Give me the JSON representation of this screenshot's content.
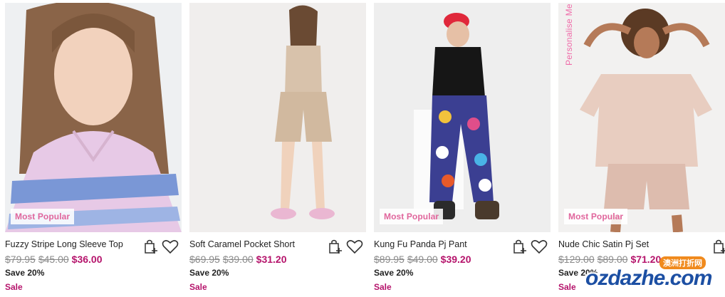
{
  "products": [
    {
      "name": "Fuzzy Stripe Long Sleeve Top",
      "badge": "Most Popular",
      "was": "$79.95",
      "was2": "$45.00",
      "now": "$36.00",
      "save": "Save 20%",
      "sale": "Sale"
    },
    {
      "name": "Soft Caramel Pocket Short",
      "badge": "",
      "was": "$69.95",
      "was2": "$39.00",
      "now": "$31.20",
      "save": "Save 20%",
      "sale": "Sale"
    },
    {
      "name": "Kung Fu Panda Pj Pant",
      "badge": "Most Popular",
      "was": "$89.95",
      "was2": "$49.00",
      "now": "$39.20",
      "save": "Save 20%",
      "sale": "Sale"
    },
    {
      "name": "Nude Chic Satin Pj Set",
      "badge": "Most Popular",
      "was": "$129.00",
      "was2": "$89.00",
      "now": "$71.20",
      "save": "Save 20%",
      "sale": "Sale"
    }
  ],
  "personalise_label": "Personalise Me",
  "watermark": {
    "site": "ozdazhe.com",
    "tag": "澳洲打折网"
  },
  "icons": {
    "bag": "add-to-bag-icon",
    "heart": "wishlist-heart-icon"
  },
  "colors": {
    "accent": "#b5136b",
    "badge_text": "#e0659c",
    "personalise": "#ef6aa8"
  }
}
